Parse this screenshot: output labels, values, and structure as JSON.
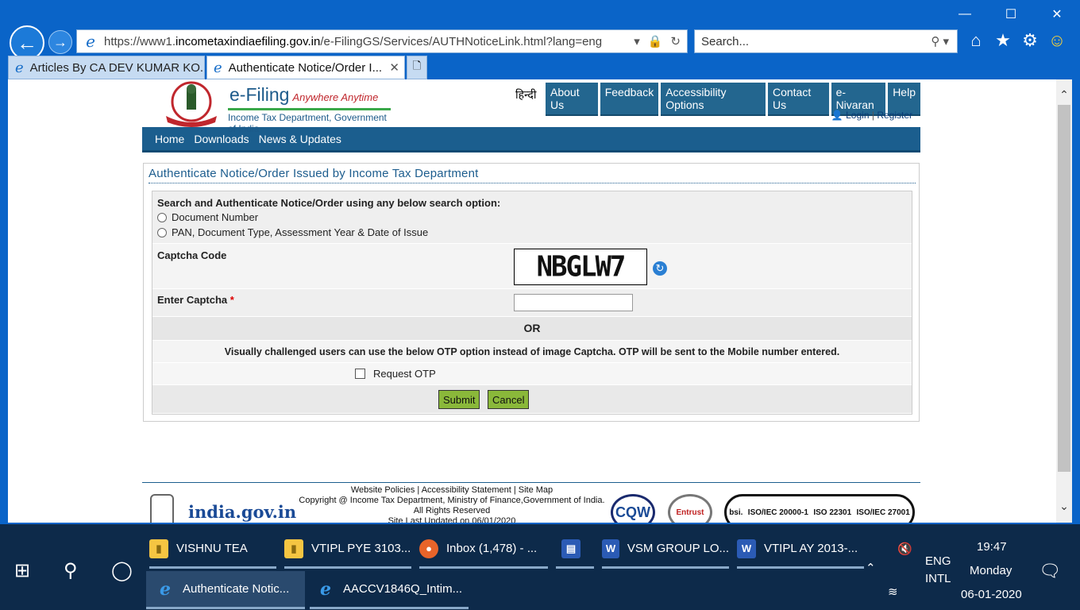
{
  "browser": {
    "url_prefix": "https://www1.",
    "url_domain": "incometaxindiaefiling.gov.in",
    "url_path": "/e-FilingGS/Services/AUTHNoticeLink.html?lang=eng",
    "search_placeholder": "Search...",
    "tabs": [
      {
        "label": "Articles By CA DEV KUMAR KO..."
      },
      {
        "label": "Authenticate Notice/Order I..."
      }
    ]
  },
  "site": {
    "logo_title": "e-Filing",
    "logo_tagline": "Anywhere Anytime",
    "logo_sub": "Income Tax Department, Government of India",
    "hindi": "हिन्दी",
    "top_nav": [
      "About Us",
      "Feedback",
      "Accessibility Options",
      "Contact Us",
      "e-Nivaran",
      "Help"
    ],
    "login": "Login",
    "register": "Register",
    "main_nav": [
      "Home",
      "Downloads",
      "News & Updates"
    ]
  },
  "form": {
    "title": "Authenticate Notice/Order Issued by Income Tax Department",
    "search_heading": "Search and Authenticate Notice/Order using any below search option:",
    "option1": "Document Number",
    "option2": "PAN, Document Type, Assessment Year & Date of Issue",
    "captcha_label": "Captcha Code",
    "captcha_value": "NBGLW7",
    "enter_captcha_label": "Enter Captcha",
    "required_mark": "*",
    "or_text": "OR",
    "visually_challenged": "Visually challenged users can use the below OTP option instead of image Captcha. OTP will be sent to the Mobile number entered.",
    "request_otp": "Request OTP",
    "submit": "Submit",
    "cancel": "Cancel"
  },
  "footer": {
    "links": "Website Policies  |  Accessibility Statement  |  Site Map",
    "copyright": "Copyright @ Income Tax Department, Ministry of Finance,Government of India.",
    "rights": "All Rights Reserved",
    "updated": "Site Last Updated on 06/01/2020",
    "india_gov": "india.gov.in"
  },
  "taskbar": {
    "items_row1": [
      "VISHNU TEA",
      "VTIPL PYE 3103...",
      "Inbox (1,478) - ...",
      "",
      "VSM GROUP LO...",
      "VTIPL AY 2013-..."
    ],
    "items_row2": [
      "Authenticate Notic...",
      "AACCV1846Q_Intim..."
    ],
    "lang1": "ENG",
    "lang2": "INTL",
    "time": "19:47",
    "day": "Monday",
    "date": "06-01-2020"
  }
}
